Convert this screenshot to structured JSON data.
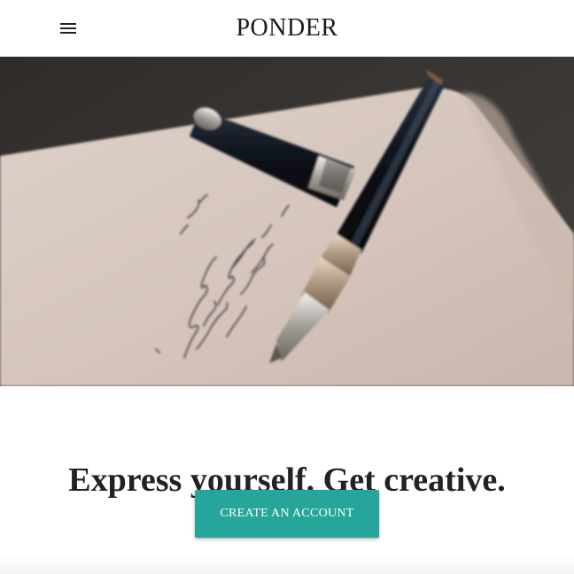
{
  "header": {
    "brand": "PONDER",
    "menu_icon": "hamburger-menu-icon"
  },
  "hero": {
    "image": "fountain-pen-on-handwritten-paper"
  },
  "main": {
    "tagline": "Express yourself. Get creative.",
    "cta_label": "CREATE AN ACCOUNT"
  },
  "colors": {
    "accent": "#26a69a",
    "text": "#222222",
    "background": "#ffffff"
  }
}
